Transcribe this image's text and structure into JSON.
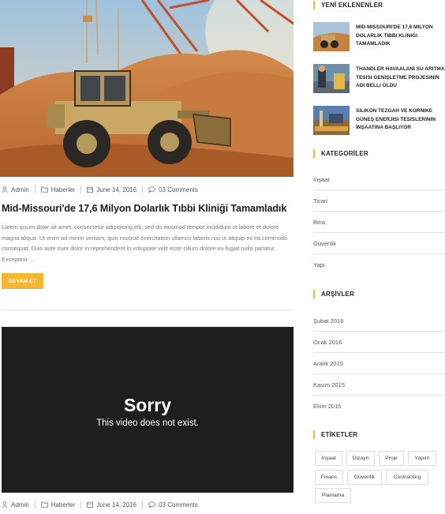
{
  "post1": {
    "meta": {
      "author": "Admin",
      "category": "Haberler",
      "date": "June 14, 2016",
      "comments": "03 Comments"
    },
    "title": "Mid-Missouri'de 17,6 Milyon Dolarlık Tıbbi Kliniği Tamamladık",
    "excerpt": "Lorem ipsum dolor sit amet, consectetur adipisicing elit, sed do eiusmod tempor incididunt ut labore et dolore magna aliqua. Ut enim ad minim veniam, quis nostrud exercitation ullamco laboris nisi ut aliquip ex ea commodo consequat. Duis aute irure dolor in reprehenderit in voluptate velit esse cillum dolore eu fugiat nulla pariatur. Excepteur ...",
    "read_more": "DEVAM ET"
  },
  "post2": {
    "video_title": "Sorry",
    "video_message": "This video does not exist.",
    "meta": {
      "author": "Admin",
      "category": "Haberler",
      "date": "June 14, 2016",
      "comments": "03 Comments"
    }
  },
  "sidebar": {
    "recent": {
      "title": "YENİ EKLENENLER",
      "items": [
        {
          "title": "MID-MISSOURI'DE 17,6 MILYON DOLARLIK TIBBI KLINIĞI TAMAMLADIK"
        },
        {
          "title": "THANDLER HAVAALANI SU ARITMA TESISI GENIŞLETME PROJESININ ADI BELLI OLDU"
        },
        {
          "title": "SILIKON TEZGAH VE KORNIKE GÜNEŞ ENERJISI TESISLERININ İNŞAATINA BAŞLIYOR"
        }
      ]
    },
    "categories": {
      "title": "KATEGORİLER",
      "items": [
        "İnşaat",
        "Ticari",
        "Bina",
        "Güvenlik",
        "Yapı"
      ]
    },
    "archives": {
      "title": "ARŞİVLER",
      "items": [
        "Şubat 2016",
        "Ocak 2016",
        "Aralık 2015",
        "Kasım 2015",
        "Ekim 2015"
      ]
    },
    "tags": {
      "title": "ETİKETLER",
      "items": [
        "İnşaat",
        "Dizayn",
        "Proje",
        "Yapım",
        "Finans",
        "Güvenlik",
        "Contracting",
        "Planlama"
      ]
    }
  },
  "colors": {
    "accent": "#f5b731",
    "video_bg": "#1e1e1e",
    "title": "#1c1c1c"
  }
}
